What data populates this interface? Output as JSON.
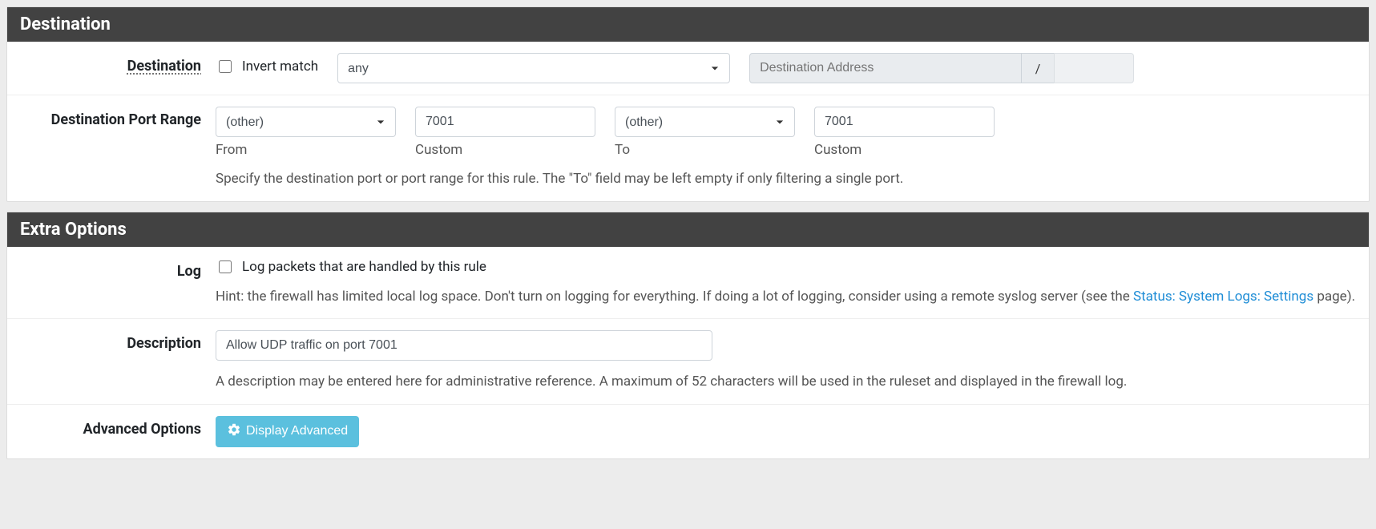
{
  "destination": {
    "header": "Destination",
    "label": "Destination",
    "invert_label": "Invert match",
    "type_value": "any",
    "address_placeholder": "Destination Address",
    "slash": "/",
    "port_range": {
      "label": "Destination Port Range",
      "from_select": "(other)",
      "from_sublabel": "From",
      "from_custom_value": "7001",
      "from_custom_sublabel": "Custom",
      "to_select": "(other)",
      "to_sublabel": "To",
      "to_custom_value": "7001",
      "to_custom_sublabel": "Custom",
      "help": "Specify the destination port or port range for this rule. The \"To\" field may be left empty if only filtering a single port."
    }
  },
  "extra": {
    "header": "Extra Options",
    "log": {
      "label": "Log",
      "checkbox_label": "Log packets that are handled by this rule",
      "help_pre": "Hint: the firewall has limited local log space. Don't turn on logging for everything. If doing a lot of logging, consider using a remote syslog server (see the ",
      "help_link": "Status: System Logs: Settings",
      "help_post": " page)."
    },
    "description": {
      "label": "Description",
      "value": "Allow UDP traffic on port 7001",
      "help": "A description may be entered here for administrative reference. A maximum of 52 characters will be used in the ruleset and displayed in the firewall log."
    },
    "advanced": {
      "label": "Advanced Options",
      "button": "Display Advanced"
    }
  }
}
